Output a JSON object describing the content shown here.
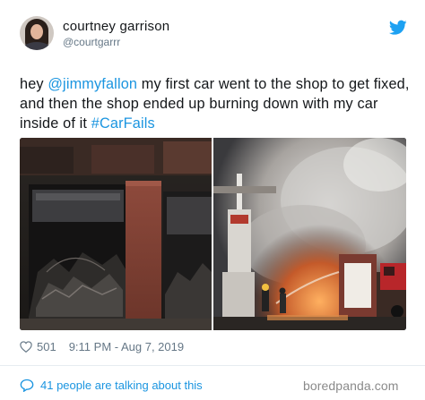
{
  "user": {
    "display_name": "courtney garrison",
    "handle": "@courtgarrr"
  },
  "tweet": {
    "text_before_mention": "hey ",
    "mention": "@jimmyfallon",
    "text_after_mention": " my first car went to the shop to get fixed, and then the shop ended up burning down with my car inside of it ",
    "hashtag": "#CarFails"
  },
  "media": {
    "left_photo": "burned-out-shop-photo",
    "right_photo": "shop-fire-photo"
  },
  "meta": {
    "likes": "501",
    "timestamp": "9:11 PM - Aug 7, 2019"
  },
  "footer": {
    "talking_text": "41 people are talking about this"
  },
  "watermark": "boredpanda.com",
  "colors": {
    "link": "#1b95e0",
    "text": "#14171a",
    "muted": "#657786",
    "twitter_blue": "#1da1f2"
  },
  "icons": {
    "brand": "twitter-bird-icon",
    "like": "heart-icon",
    "conversation": "speech-bubble-icon"
  }
}
